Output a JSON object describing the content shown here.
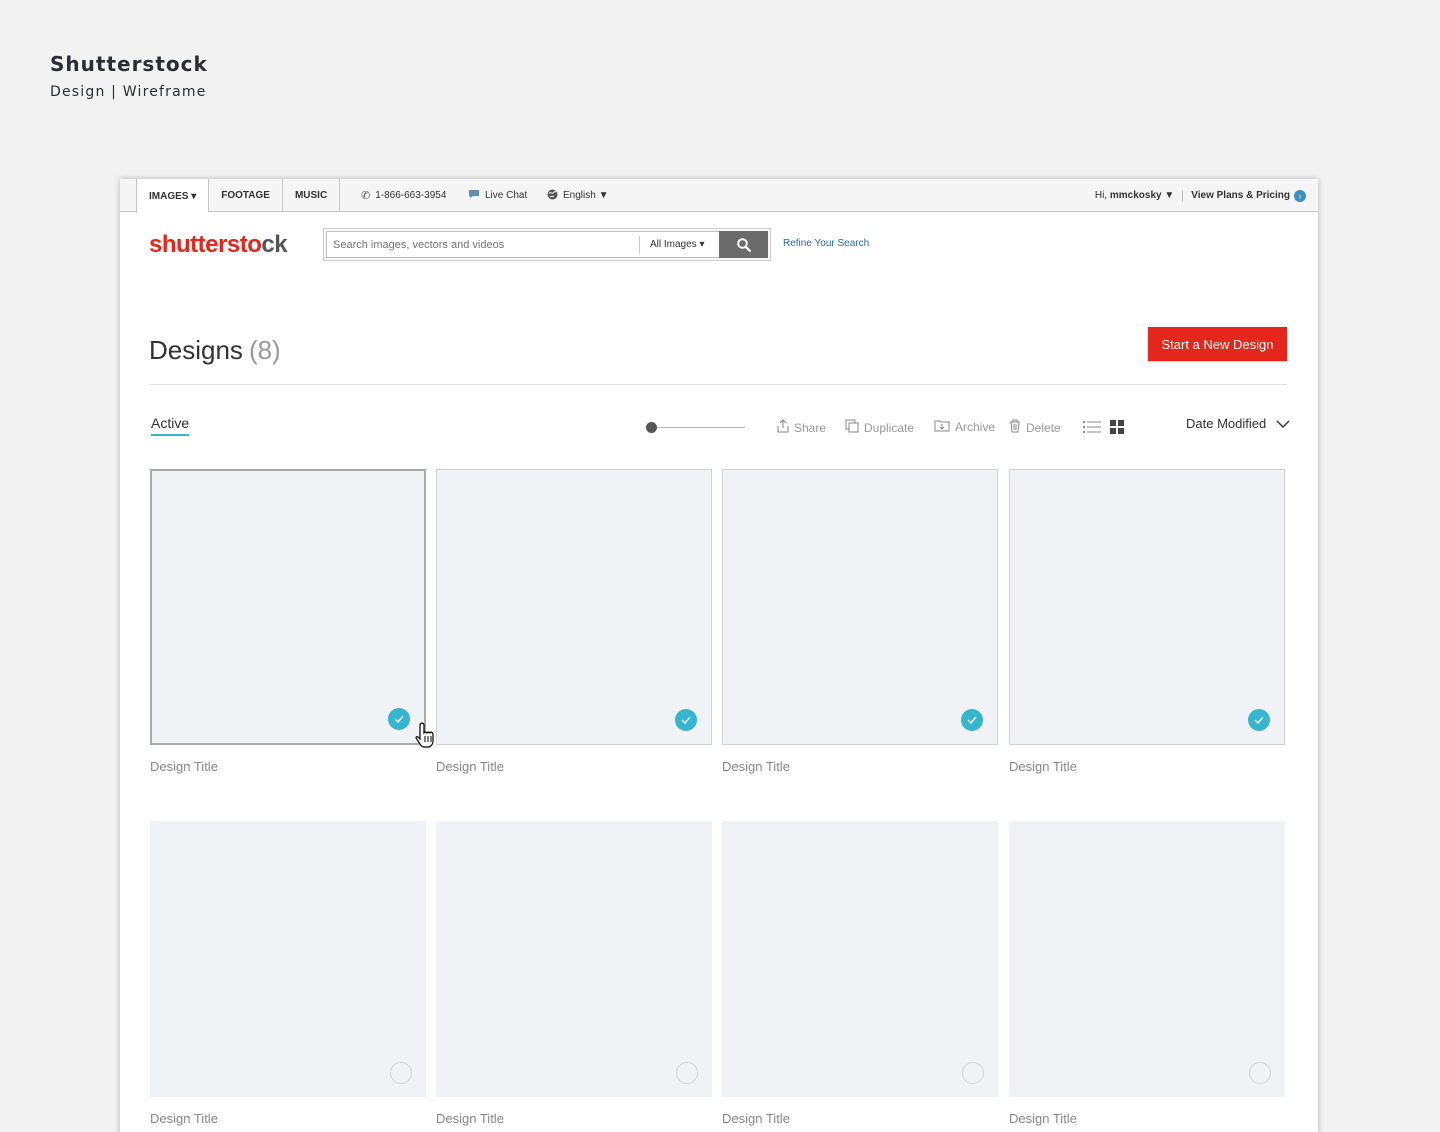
{
  "caption": {
    "title": "Shutterstock",
    "subtitle": "Design | Wireframe"
  },
  "topbar": {
    "tabs": [
      {
        "label": "IMAGES ▾",
        "active": true
      },
      {
        "label": "FOOTAGE",
        "active": false
      },
      {
        "label": "MUSIC",
        "active": false
      }
    ],
    "phone": "1-866-663-3954",
    "chat": "Live Chat",
    "language": "English ▼",
    "greeting_prefix": "Hi,",
    "username": "mmckosky ▼",
    "plans": "View Plans & Pricing"
  },
  "logo": {
    "part1": "shutterst",
    "part2": "ck",
    "mark": "o"
  },
  "search": {
    "placeholder": "Search images, vectors and videos",
    "category": "All Images ▾",
    "refine": "Refine Your Search"
  },
  "page": {
    "title": "Designs",
    "count": "(8)",
    "new_button": "Start a New Design"
  },
  "toolbar": {
    "filter": "Active",
    "share": "Share",
    "duplicate": "Duplicate",
    "archive": "Archive",
    "delete": "Delete",
    "sort": "Date Modified"
  },
  "designs": [
    {
      "title": "Design Title",
      "checked": true
    },
    {
      "title": "Design Title",
      "checked": true
    },
    {
      "title": "Design Title",
      "checked": true
    },
    {
      "title": "Design Title",
      "checked": true
    },
    {
      "title": "Design Title",
      "checked": false
    },
    {
      "title": "Design Title",
      "checked": false
    },
    {
      "title": "Design Title",
      "checked": false
    },
    {
      "title": "Design Title",
      "checked": false
    }
  ],
  "colors": {
    "brand_red": "#e5261c",
    "accent_teal": "#36b5cf",
    "link_blue": "#2d6aa3"
  }
}
